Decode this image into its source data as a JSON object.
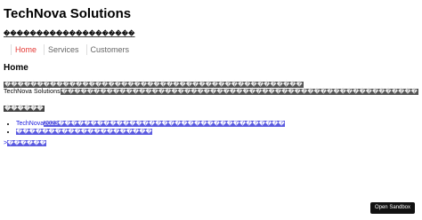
{
  "header": {
    "title": "TechNova Solutions",
    "tagline": "��������������������"
  },
  "nav": {
    "items": [
      {
        "label": "Home",
        "active": true
      },
      {
        "label": "Services",
        "active": false
      },
      {
        "label": "Customers",
        "active": false
      }
    ]
  },
  "main": {
    "heading": "Home",
    "paragraph_line1": "����������������������������������������������",
    "paragraph_line2_prefix": "TechNova Solutions",
    "paragraph_line2_rest": "�������������������������������������������������������",
    "subheading": "������",
    "list": [
      {
        "lead": "TechNova",
        "rest": "2023�����������������������������������"
      },
      {
        "lead": "",
        "rest": "���������������������"
      }
    ],
    "more_prefix": ">",
    "more_text": "������"
  },
  "footer": {
    "sandbox_button": "Open Sandbox"
  },
  "colors": {
    "nav_active": "#e53935",
    "link": "#1a1adf",
    "highlight": "#5b5be0",
    "button_bg": "#111111"
  }
}
